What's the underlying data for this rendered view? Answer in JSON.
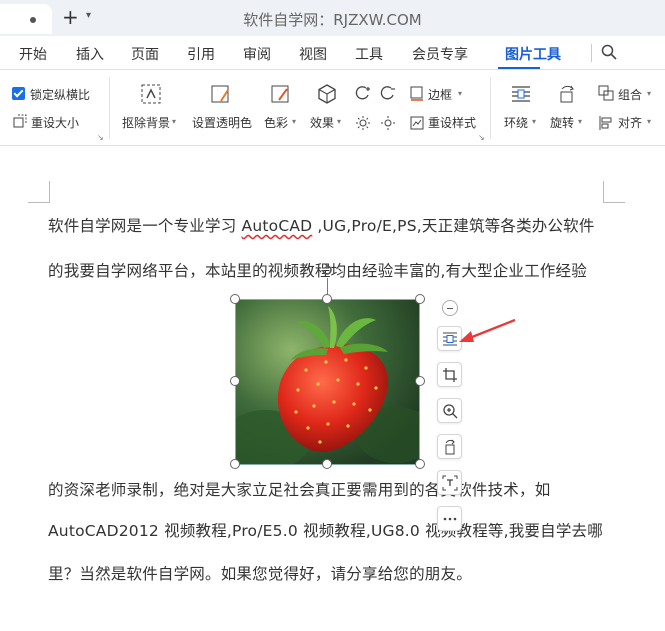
{
  "window": {
    "title": "软件自学网：RJZXW.COM"
  },
  "menu": {
    "items": [
      "开始",
      "插入",
      "页面",
      "引用",
      "审阅",
      "视图",
      "工具",
      "会员专享",
      "图片工具"
    ],
    "active": "图片工具"
  },
  "ribbon": {
    "lock_ratio": "锁定纵横比",
    "reset_size": "重设大小",
    "remove_bg": "抠除背景",
    "set_transparent": "设置透明色",
    "color": "色彩",
    "effect": "效果",
    "border": "边框",
    "reset_style": "重设样式",
    "wrap": "环绕",
    "rotate": "旋转",
    "group": "组合",
    "align": "对齐"
  },
  "document": {
    "p1_pre": "软件自学网是一个专业学习 ",
    "p1_autocad": "AutoCAD",
    "p1_post": " ,UG,Pro/E,PS,天正建筑等各类办公软件",
    "p2": "的我要自学网络平台，本站里的视频教程均由经验丰富的,有大型企业工作经验",
    "p3": "的资深老师录制，绝对是大家立足社会真正要需用到的各类软件技术，如",
    "p4": "AutoCAD2012 视频教程,Pro/E5.0 视频教程,UG8.0 视频教程等,我要自学去哪",
    "p5": "里？当然是软件自学网。如果您觉得好，请分享给您的朋友。"
  },
  "colors": {
    "accent": "#1a5fd6",
    "arrow": "#e83a3a"
  }
}
